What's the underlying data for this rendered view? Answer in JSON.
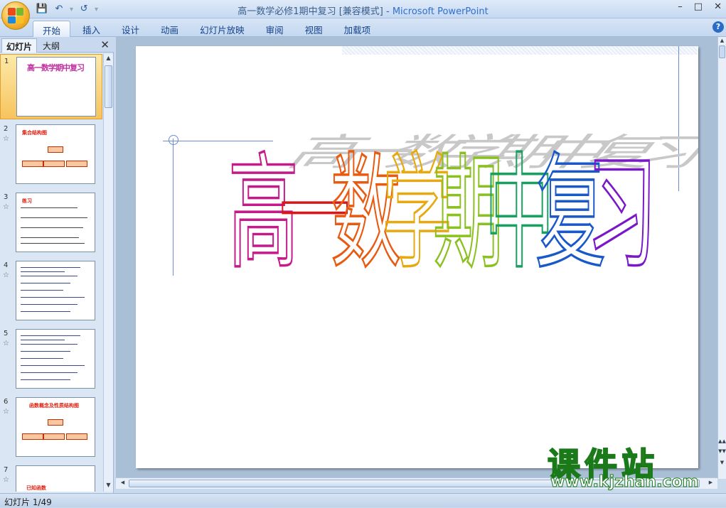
{
  "window": {
    "title_main": "高一数学必修1期中复习 [兼容模式] - ",
    "title_brand": "Microsoft PowerPoint"
  },
  "ribbon": {
    "tabs": [
      "开始",
      "插入",
      "设计",
      "动画",
      "幻灯片放映",
      "审阅",
      "视图",
      "加载项"
    ],
    "active": "开始"
  },
  "panel": {
    "tab_slides": "幻灯片",
    "tab_outline": "大纲"
  },
  "thumbnails": [
    {
      "num": "1",
      "text": "高一数学期中复习"
    },
    {
      "num": "2",
      "text": "集合结构图"
    },
    {
      "num": "3",
      "text": "练习"
    },
    {
      "num": "4",
      "text": ""
    },
    {
      "num": "5",
      "text": ""
    },
    {
      "num": "6",
      "text": "函数概念及性质结构图"
    },
    {
      "num": "7",
      "text": "已知函数"
    }
  ],
  "slide": {
    "title": "高一数学期中复习",
    "letters": [
      "高",
      "一",
      "数",
      "学",
      "期",
      "中",
      "复",
      "习"
    ]
  },
  "colors": {
    "letters": [
      "#c41a8a",
      "#d81818",
      "#e85a10",
      "#e8a810",
      "#8ac020",
      "#18a060",
      "#1858c8",
      "#7a18c8"
    ]
  },
  "status": {
    "text": "幻灯片 1/49"
  },
  "watermark": {
    "cn": "课件站",
    "url": "www.kjzhan.com"
  }
}
